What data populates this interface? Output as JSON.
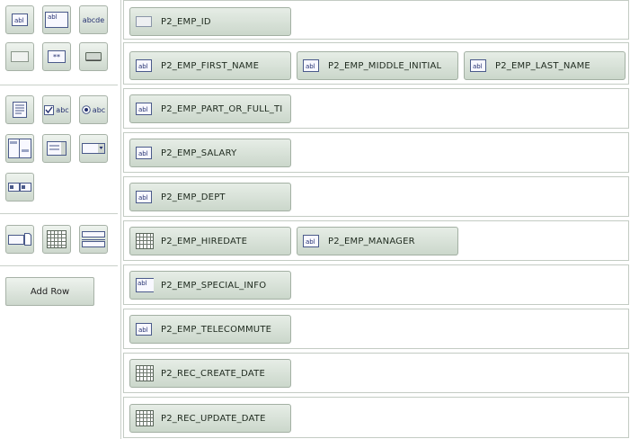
{
  "palette": {
    "tools": [
      {
        "name": "text-field-tool-icon"
      },
      {
        "name": "text-area-tool-icon"
      },
      {
        "name": "label-text-tool-icon",
        "text": "abcde"
      },
      {
        "name": "plain-input-tool-icon"
      },
      {
        "name": "password-field-tool-icon",
        "text": "**"
      },
      {
        "name": "button-tool-icon"
      },
      {
        "name": "document-tool-icon"
      },
      {
        "name": "checkbox-tool-icon",
        "text": "abc"
      },
      {
        "name": "radio-button-tool-icon",
        "text": "abc"
      },
      {
        "name": "shuttle-list-tool-icon"
      },
      {
        "name": "list-box-tool-icon"
      },
      {
        "name": "select-list-tool-icon"
      },
      {
        "name": "popup-list-tool-icon"
      },
      {
        "name": "file-browse-tool-icon"
      },
      {
        "name": "date-picker-tool-icon"
      },
      {
        "name": "horizontal-rule-tool-icon"
      }
    ],
    "add_row_label": "Add Row"
  },
  "rows": [
    {
      "fields": [
        {
          "icon": "empty-input-icon",
          "label": "P2_EMP_ID"
        }
      ]
    },
    {
      "fields": [
        {
          "icon": "text-field-icon",
          "label": "P2_EMP_FIRST_NAME"
        },
        {
          "icon": "text-field-icon",
          "label": "P2_EMP_MIDDLE_INITIAL"
        },
        {
          "icon": "text-field-icon",
          "label": "P2_EMP_LAST_NAME"
        }
      ]
    },
    {
      "fields": [
        {
          "icon": "text-field-icon",
          "label": "P2_EMP_PART_OR_FULL_TI"
        }
      ]
    },
    {
      "fields": [
        {
          "icon": "text-field-icon",
          "label": "P2_EMP_SALARY"
        }
      ]
    },
    {
      "fields": [
        {
          "icon": "text-field-icon",
          "label": "P2_EMP_DEPT"
        }
      ]
    },
    {
      "fields": [
        {
          "icon": "date-picker-icon",
          "label": "P2_EMP_HIREDATE"
        },
        {
          "icon": "text-field-icon",
          "label": "P2_EMP_MANAGER"
        }
      ]
    },
    {
      "fields": [
        {
          "icon": "text-area-icon",
          "label": "P2_EMP_SPECIAL_INFO"
        }
      ]
    },
    {
      "fields": [
        {
          "icon": "text-field-icon",
          "label": "P2_EMP_TELECOMMUTE"
        }
      ]
    },
    {
      "fields": [
        {
          "icon": "date-picker-icon",
          "label": "P2_REC_CREATE_DATE"
        }
      ]
    },
    {
      "fields": [
        {
          "icon": "date-picker-icon",
          "label": "P2_REC_UPDATE_DATE"
        }
      ]
    }
  ]
}
